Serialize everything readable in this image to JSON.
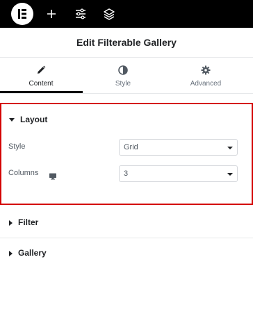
{
  "toolbar": {
    "logo_icon": "elementor-logo-icon",
    "add_icon": "plus-icon",
    "settings_icon": "sliders-icon",
    "structure_icon": "layers-icon"
  },
  "panel": {
    "title": "Edit Filterable Gallery"
  },
  "tabs": [
    {
      "label": "Content",
      "icon": "pencil-icon",
      "active": true
    },
    {
      "label": "Style",
      "icon": "half-circle-icon",
      "active": false
    },
    {
      "label": "Advanced",
      "icon": "gear-icon",
      "active": false
    }
  ],
  "sections": {
    "layout": {
      "title": "Layout",
      "expanded": true,
      "controls": {
        "style": {
          "label": "Style",
          "value": "Grid"
        },
        "columns": {
          "label": "Columns",
          "value": "3",
          "device_icon": "desktop-icon"
        }
      }
    },
    "filter": {
      "title": "Filter",
      "expanded": false
    },
    "gallery": {
      "title": "Gallery",
      "expanded": false
    }
  },
  "colors": {
    "topbar": "#000000",
    "highlight_border": "#d40000",
    "text": "#1f2124",
    "muted": "#69727d"
  }
}
